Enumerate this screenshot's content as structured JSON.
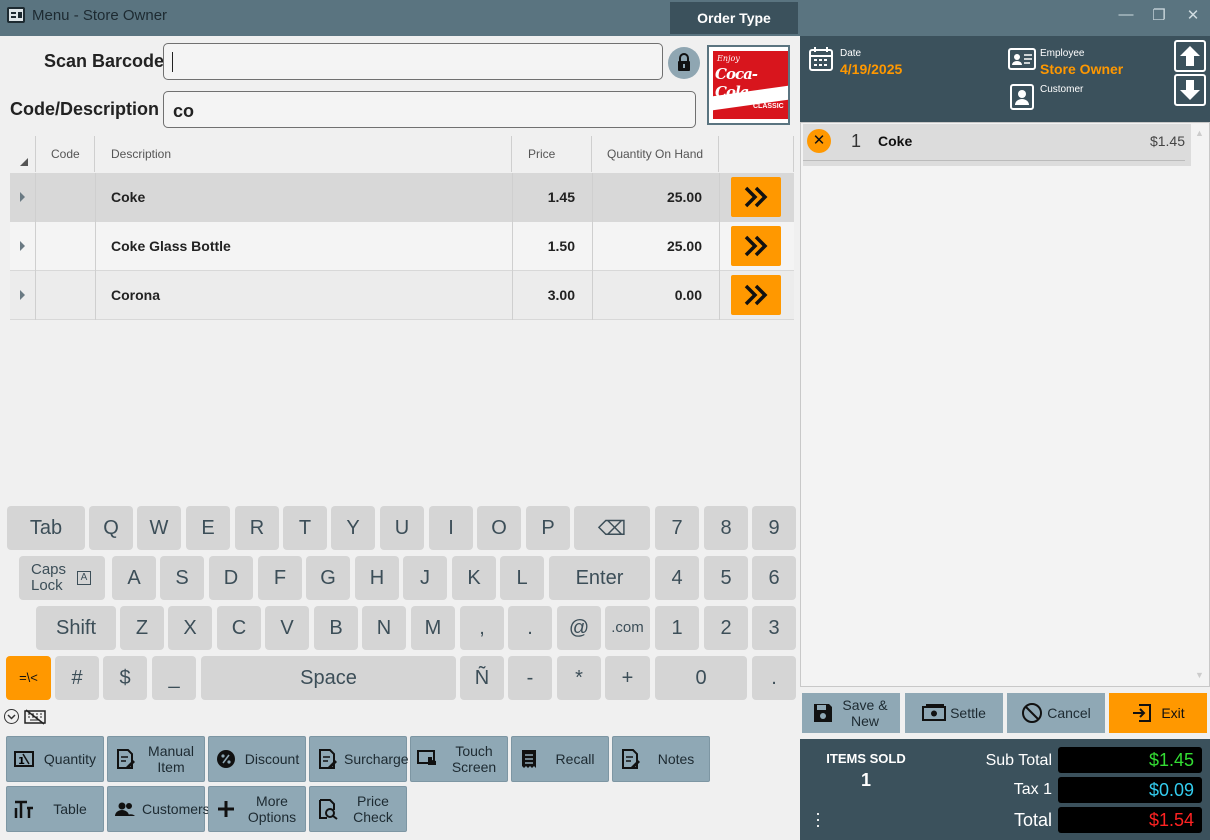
{
  "window": {
    "title": "Menu - Store Owner",
    "order_type": "Order Type",
    "minimize": "—",
    "restore": "❐",
    "close": "✕"
  },
  "scan": {
    "barcode_label": "Scan Barcode",
    "barcode_value": "",
    "code_label": "Code/Description",
    "code_value": "co"
  },
  "product_image": {
    "brand_top": "Enjoy",
    "brand": "Coca-Cola",
    "brand_sub": "CLASSIC"
  },
  "grid": {
    "columns": [
      "Code",
      "Description",
      "Price",
      "Quantity On Hand"
    ],
    "rows": [
      {
        "code": "",
        "description": "Coke",
        "price": "1.45",
        "qty": "25.00"
      },
      {
        "code": "",
        "description": "Coke Glass Bottle",
        "price": "1.50",
        "qty": "25.00"
      },
      {
        "code": "",
        "description": "Corona",
        "price": "3.00",
        "qty": "0.00"
      }
    ]
  },
  "keyboard": {
    "row1": [
      "Tab",
      "Q",
      "W",
      "E",
      "R",
      "T",
      "Y",
      "U",
      "I",
      "O",
      "P",
      "⌫",
      "7",
      "8",
      "9"
    ],
    "row2": [
      "Caps Lock",
      "A",
      "S",
      "D",
      "F",
      "G",
      "H",
      "J",
      "K",
      "L",
      "Enter",
      "4",
      "5",
      "6"
    ],
    "row3": [
      "Shift",
      "Z",
      "X",
      "C",
      "V",
      "B",
      "N",
      "M",
      ",",
      ".",
      "@",
      ".com",
      "1",
      "2",
      "3"
    ],
    "row4": [
      "=\\<",
      "#",
      "$",
      "_",
      "Space",
      "Ñ",
      "-",
      "*",
      "+",
      "0",
      "."
    ]
  },
  "functions": {
    "row1": [
      "Quantity",
      "Manual Item",
      "Discount",
      "Surcharge",
      "Touch Screen",
      "Recall",
      "Notes"
    ],
    "row2": [
      "Table",
      "Customers",
      "More Options",
      "Price Check"
    ]
  },
  "header": {
    "date_label": "Date",
    "date_value": "4/19/2025",
    "employee_label": "Employee",
    "employee_value": "Store Owner",
    "customer_label": "Customer"
  },
  "order": {
    "items": [
      {
        "qty": "1",
        "name": "Coke",
        "price": "$1.45"
      }
    ]
  },
  "actions": {
    "save_new": "Save & New",
    "settle": "Settle",
    "cancel": "Cancel",
    "exit": "Exit"
  },
  "totals": {
    "items_sold_label": "ITEMS SOLD",
    "items_sold": "1",
    "subtotal_label": "Sub Total",
    "subtotal": "$1.45",
    "tax_label": "Tax 1",
    "tax": "$0.09",
    "total_label": "Total",
    "total": "$1.54"
  },
  "colors": {
    "accent": "#ff9800",
    "header": "#3b515c",
    "titlebar": "#5a7480",
    "button": "#8fa8b5",
    "subtotal": "#33dd33",
    "tax": "#33ccee",
    "total": "#ff2222"
  }
}
